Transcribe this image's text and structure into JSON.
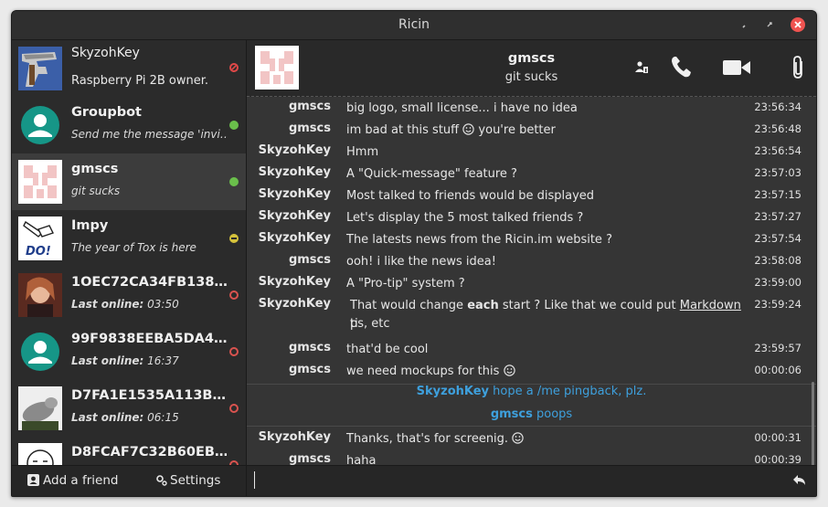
{
  "window": {
    "title": "Ricin"
  },
  "self": {
    "name": "SkyzohKey",
    "status_message": "Raspberry Pi 2B owner."
  },
  "contacts": [
    {
      "name": "Groupbot",
      "sub_prefix": "",
      "sub": "Send me the message 'invi…",
      "status": "online"
    },
    {
      "name": "gmscs",
      "sub_prefix": "",
      "sub": "git sucks",
      "status": "online"
    },
    {
      "name": "Impy",
      "sub_prefix": "",
      "sub": "The year of Tox is here",
      "status": "away"
    },
    {
      "name": "1OEC72CA34FB138…",
      "sub_prefix": "Last online:",
      "sub": "03:50",
      "status": "offline"
    },
    {
      "name": "99F9838EEBA5DA4…",
      "sub_prefix": "Last online:",
      "sub": "16:37",
      "status": "offline"
    },
    {
      "name": "D7FA1E1535A113B…",
      "sub_prefix": "Last online:",
      "sub": "06:15",
      "status": "offline"
    },
    {
      "name": "D8FCAF7C32B60EB…",
      "sub_prefix": "",
      "sub": "",
      "status": "offline"
    }
  ],
  "footer": {
    "add_friend": "Add a friend",
    "settings": "Settings"
  },
  "chat": {
    "name": "gmscs",
    "status_message": "git sucks",
    "messages": [
      {
        "author": "gmscs",
        "text": "big logo, small license... i have no idea",
        "time": "23:56:34"
      },
      {
        "author": "gmscs",
        "text": "im bad at this stuff",
        "text_after": "you're better",
        "emoji": true,
        "time": "23:56:48"
      },
      {
        "author": "SkyzohKey",
        "text": "Hmm",
        "time": "23:56:54"
      },
      {
        "author": "SkyzohKey",
        "text": "A \"Quick-message\" feature ?",
        "time": "23:57:03"
      },
      {
        "author": "SkyzohKey",
        "text": "Most talked to friends would be displayed",
        "time": "23:57:15"
      },
      {
        "author": "SkyzohKey",
        "text": "Let's display the 5 most talked friends ?",
        "time": "23:57:27"
      },
      {
        "author": "SkyzohKey",
        "text": "The latests news from the Ricin.im website ?",
        "time": "23:57:54"
      },
      {
        "author": "gmscs",
        "text": "ooh! i like the news idea!",
        "time": "23:58:08"
      },
      {
        "author": "SkyzohKey",
        "text": "A \"Pro-tip\" system ?",
        "time": "23:59:00"
      },
      {
        "author": "SkyzohKey",
        "text_1": "That would change",
        "bold": "each",
        "text_2": "start ? Like that we could put",
        "link": "Markdown",
        "text_3": "ti",
        "text_4": "ps, etc",
        "time": "23:59:24"
      },
      {
        "author": "gmscs",
        "text": "that'd be cool",
        "time": "23:59:57"
      },
      {
        "author": "gmscs",
        "text": "we need mockups for this",
        "emoji": true,
        "time": "00:00:06"
      },
      {
        "action_author": "SkyzohKey",
        "action_text": "hope a /me pingback, plz."
      },
      {
        "action_author": "gmscs",
        "action_text": "poops"
      },
      {
        "author": "SkyzohKey",
        "text": "Thanks, that's for screenig.",
        "emoji": true,
        "time": "00:00:31"
      },
      {
        "author": "gmscs",
        "text": "haha",
        "time": "00:00:39"
      }
    ]
  },
  "colors": {
    "online": "#6abf4b",
    "away": "#d4c13b",
    "offline": "#d9534f",
    "action": "#3ea0dd"
  }
}
